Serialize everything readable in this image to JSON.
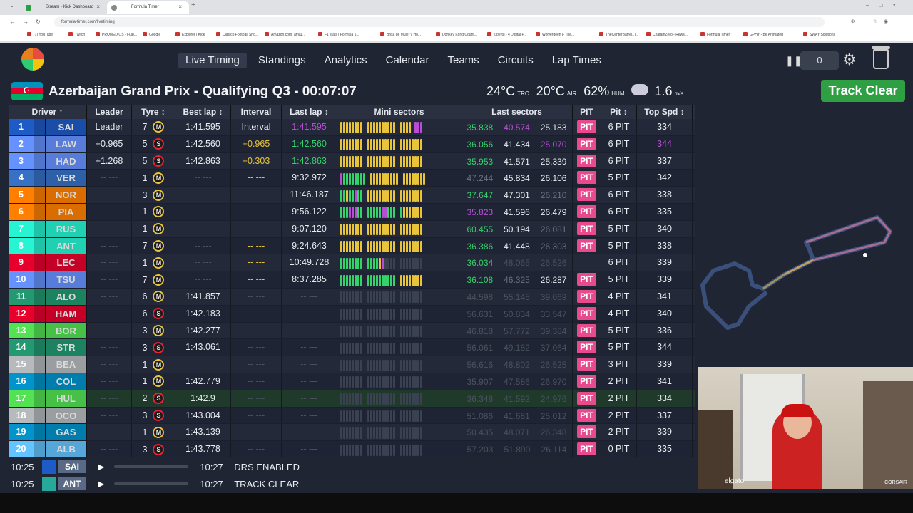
{
  "browser": {
    "tabs": [
      {
        "label": "Stream - Kick Dashboard"
      },
      {
        "label": "Formula Timer"
      }
    ],
    "url": "formula-timer.com/livetiming",
    "bookmarks": [
      "(1) YouTube",
      "Twitch",
      "PROMEDIOS - Fulb...",
      "Google",
      "Explorer | Kick",
      "Clasico Football Sho...",
      "Amazon.com: amaz...",
      "F1 stats | Formula 1...",
      "Brisa de Mujer y Ho...",
      "Donkey Kong Count...",
      "Zipertu - 4 Digital P...",
      "Wolverdeen F The...",
      "TheCenterBarrel1T...",
      "ChatamZero - Rews...",
      "Formula Timer",
      "GPHY - Be Animated",
      "SWAY Solutions"
    ]
  },
  "nav": {
    "items": [
      "Live Timing",
      "Standings",
      "Analytics",
      "Calendar",
      "Teams",
      "Circuits",
      "Lap Times"
    ],
    "counter": "0"
  },
  "session": {
    "title": "Azerbaijan Grand Prix - Qualifying Q3 - 00:07:07",
    "track_temp": "24°C",
    "track_temp_unit": "TRC",
    "air_temp": "20°C",
    "air_temp_unit": "AIR",
    "humidity": "62%",
    "humidity_unit": "HUM",
    "wind": "1.6",
    "wind_unit": "m/s",
    "status": "Track Clear"
  },
  "columns": [
    "Driver ↑",
    "Leader",
    "Tyre ↕",
    "Best lap ↕",
    "Interval",
    "Last lap ↕",
    "Mini sectors",
    "Last sectors",
    "PIT",
    "Pit ↕",
    "Top Spd ↕"
  ],
  "colors": {
    "pit": "#e84a8e",
    "purple": "#b94cd6",
    "green": "#33d26a",
    "yellow": "#e8c43a",
    "track_clear": "#2ea043"
  },
  "drivers": [
    {
      "pos": "1",
      "code": "SAI",
      "team_color": "#1e5bc6",
      "leader": "Leader",
      "laps": "7",
      "tyre": "M",
      "best": "1:41.595",
      "interval": "Interval",
      "last": "1:41.595",
      "last_c": "purple",
      "s1": "35.838",
      "s1c": "green",
      "s2": "40.574",
      "s2c": "purple",
      "s3": "25.183",
      "s3c": "",
      "pit": "PIT",
      "pits": "6 PIT",
      "spd": "334",
      "spd_c": "",
      "mini": "yyyyyyyy|yyyyyyyyyy|yyyymppp"
    },
    {
      "pos": "2",
      "code": "LAW",
      "team_color": "#6692ff",
      "leader": "+0.965",
      "laps": "5",
      "tyre": "S",
      "best": "1:42.560",
      "interval": "+0.965",
      "int_c": "yellow",
      "last": "1:42.560",
      "last_c": "green",
      "s1": "36.056",
      "s1c": "",
      "s2": "41.434",
      "s2c": "",
      "s3": "25.070",
      "s3c": "purple",
      "pit": "PIT",
      "pits": "6 PIT",
      "spd": "344",
      "spd_c": "purple",
      "mini": "yyyyyyyy|yyyyyyyyyy|yyyyyyyy"
    },
    {
      "pos": "3",
      "code": "HAD",
      "team_color": "#6692ff",
      "leader": "+1.268",
      "laps": "5",
      "tyre": "S",
      "best": "1:42.863",
      "interval": "+0.303",
      "int_c": "yellow",
      "last": "1:42.863",
      "last_c": "green",
      "s1": "35.953",
      "s1c": "",
      "s2": "41.571",
      "s2c": "",
      "s3": "25.339",
      "s3c": "",
      "pit": "PIT",
      "pits": "6 PIT",
      "spd": "337",
      "spd_c": "",
      "mini": "yyyyyyyy|yyyyyyyyyy|yyyyyyyy"
    },
    {
      "pos": "4",
      "code": "VER",
      "team_color": "#3671c6",
      "leader": "-- ---",
      "laps": "1",
      "tyre": "M",
      "best": "-- ---",
      "interval": "-- ---",
      "int_c": "yellow",
      "last": "9:32.972",
      "last_c": "",
      "s1": "47.244",
      "s1c": "dim",
      "s2": "45.834",
      "s2c": "",
      "s3": "26.106",
      "s3c": "",
      "pit": "PIT",
      "pits": "5 PIT",
      "spd": "342",
      "spd_c": "",
      "mini": "pgggggggg|yyyyyyyyyy|yyyyyyyy"
    },
    {
      "pos": "5",
      "code": "NOR",
      "team_color": "#ff8000",
      "leader": "-- ---",
      "laps": "3",
      "tyre": "M",
      "best": "-- ---",
      "interval": "-- ---",
      "int_c": "yellow",
      "last": "11:46.187",
      "last_c": "",
      "s1": "37.647",
      "s1c": "",
      "s2": "47.301",
      "s2c": "",
      "s3": "26.210",
      "s3c": "dim",
      "pit": "PIT",
      "pits": "6 PIT",
      "spd": "338",
      "spd_c": "",
      "mini": "ggyggpgg|yyyyyyyyyy|yyyyyyyy"
    },
    {
      "pos": "6",
      "code": "PIA",
      "team_color": "#ff8000",
      "leader": "-- ---",
      "laps": "1",
      "tyre": "M",
      "best": "-- ---",
      "interval": "-- ---",
      "int_c": "yellow",
      "last": "9:56.122",
      "last_c": "",
      "s1": "35.823",
      "s1c": "purple",
      "s2": "41.596",
      "s2c": "",
      "s3": "26.479",
      "s3c": "",
      "pit": "PIT",
      "pits": "6 PIT",
      "spd": "335",
      "spd_c": "",
      "mini": "gggpppgg|gggggppggg|gyyyyyyy"
    },
    {
      "pos": "7",
      "code": "RUS",
      "team_color": "#27f4d2",
      "leader": "-- ---",
      "laps": "1",
      "tyre": "M",
      "best": "-- ---",
      "interval": "-- ---",
      "int_c": "yellow",
      "last": "9:07.120",
      "last_c": "",
      "s1": "60.455",
      "s1c": "",
      "s2": "50.194",
      "s2c": "",
      "s3": "26.081",
      "s3c": "dim",
      "pit": "PIT",
      "pits": "5 PIT",
      "spd": "340",
      "spd_c": "",
      "mini": "yyyyyyyy|yyyyyyyyyy|yyyyyyyy"
    },
    {
      "pos": "8",
      "code": "ANT",
      "team_color": "#27f4d2",
      "leader": "-- ---",
      "laps": "7",
      "tyre": "M",
      "best": "-- ---",
      "interval": "-- ---",
      "int_c": "yellow",
      "last": "9:24.643",
      "last_c": "",
      "s1": "36.386",
      "s1c": "",
      "s2": "41.448",
      "s2c": "",
      "s3": "26.303",
      "s3c": "dim",
      "pit": "PIT",
      "pits": "5 PIT",
      "spd": "338",
      "spd_c": "",
      "mini": "yyyyyyyy|yyyyyyyyyy|yyyyyyyy"
    },
    {
      "pos": "9",
      "code": "LEC",
      "team_color": "#e8002d",
      "leader": "-- ---",
      "laps": "1",
      "tyre": "M",
      "best": "-- ---",
      "interval": "-- ---",
      "int_c": "yellow",
      "last": "10:49.728",
      "last_c": "",
      "s1": "36.034",
      "s1c": "",
      "s2": "48.065",
      "s2c": "dim2",
      "s3": "26.526",
      "s3c": "dim2",
      "pit": "",
      "pits": "6 PIT",
      "spd": "339",
      "spd_c": "",
      "mini": "gggggggg|ggggyp....|........"
    },
    {
      "pos": "10",
      "code": "TSU",
      "team_color": "#6692ff",
      "leader": "-- ---",
      "laps": "7",
      "tyre": "M",
      "best": "-- ---",
      "interval": "-- ---",
      "int_c": "yellow",
      "last": "8:37.285",
      "last_c": "",
      "s1": "36.108",
      "s1c": "",
      "s2": "46.325",
      "s2c": "dim",
      "s3": "26.287",
      "s3c": "",
      "pit": "PIT",
      "pits": "5 PIT",
      "spd": "339",
      "spd_c": "",
      "mini": "gggggggg|gggggggggg|yyyyyyyy"
    },
    {
      "pos": "11",
      "code": "ALO",
      "team_color": "#229971",
      "leader": "-- ---",
      "laps": "6",
      "tyre": "M",
      "best": "1:41.857",
      "interval": "-- ---",
      "int_c": "",
      "last": "-- ---",
      "last_c": "",
      "s1": "44.598",
      "s1c": "dim2",
      "s2": "55.145",
      "s2c": "dim2",
      "s3": "39.069",
      "s3c": "dim2",
      "pit": "PIT",
      "pits": "4 PIT",
      "spd": "341",
      "spd_c": "",
      "mini": "........|..........|........"
    },
    {
      "pos": "12",
      "code": "HAM",
      "team_color": "#e8002d",
      "leader": "-- ---",
      "laps": "6",
      "tyre": "S",
      "best": "1:42.183",
      "interval": "-- ---",
      "int_c": "",
      "last": "-- ---",
      "last_c": "",
      "s1": "56.631",
      "s1c": "dim2",
      "s2": "50.834",
      "s2c": "dim2",
      "s3": "33.547",
      "s3c": "dim2",
      "pit": "PIT",
      "pits": "4 PIT",
      "spd": "340",
      "spd_c": "",
      "mini": "........|..........|........"
    },
    {
      "pos": "13",
      "code": "BOR",
      "team_color": "#52e252",
      "leader": "-- ---",
      "laps": "3",
      "tyre": "M",
      "best": "1:42.277",
      "interval": "-- ---",
      "int_c": "",
      "last": "-- ---",
      "last_c": "",
      "s1": "46.818",
      "s1c": "dim2",
      "s2": "57.772",
      "s2c": "dim2",
      "s3": "39.384",
      "s3c": "dim2",
      "pit": "PIT",
      "pits": "5 PIT",
      "spd": "336",
      "spd_c": "",
      "mini": "........|..........|........"
    },
    {
      "pos": "14",
      "code": "STR",
      "team_color": "#229971",
      "leader": "-- ---",
      "laps": "3",
      "tyre": "S",
      "best": "1:43.061",
      "interval": "-- ---",
      "int_c": "",
      "last": "-- ---",
      "last_c": "",
      "s1": "56.061",
      "s1c": "dim2",
      "s2": "49.182",
      "s2c": "dim2",
      "s3": "37.064",
      "s3c": "dim2",
      "pit": "PIT",
      "pits": "5 PIT",
      "spd": "344",
      "spd_c": "",
      "mini": "........|..........|........"
    },
    {
      "pos": "15",
      "code": "BEA",
      "team_color": "#b6babd",
      "leader": "-- ---",
      "laps": "1",
      "tyre": "M",
      "best": "",
      "interval": "-- ---",
      "int_c": "",
      "last": "-- ---",
      "last_c": "",
      "s1": "56.616",
      "s1c": "dim2",
      "s2": "48.802",
      "s2c": "dim2",
      "s3": "26.525",
      "s3c": "dim2",
      "pit": "PIT",
      "pits": "3 PIT",
      "spd": "339",
      "spd_c": "",
      "mini": "........|..........|........"
    },
    {
      "pos": "16",
      "code": "COL",
      "team_color": "#0093cc",
      "leader": "-- ---",
      "laps": "1",
      "tyre": "M",
      "best": "1:42.779",
      "interval": "-- ---",
      "int_c": "",
      "last": "-- ---",
      "last_c": "",
      "s1": "35.907",
      "s1c": "dim2",
      "s2": "47.586",
      "s2c": "dim2",
      "s3": "26.970",
      "s3c": "dim2",
      "pit": "PIT",
      "pits": "2 PIT",
      "spd": "341",
      "spd_c": "",
      "mini": "........|..........|........"
    },
    {
      "pos": "17",
      "code": "HUL",
      "team_color": "#52e252",
      "leader": "-- ---",
      "laps": "2",
      "tyre": "S",
      "best": "1:42.9",
      "interval": "-- ---",
      "int_c": "",
      "last": "-- ---",
      "last_c": "",
      "s1": "36.348",
      "s1c": "dim2",
      "s2": "41.592",
      "s2c": "dim2",
      "s3": "24.976",
      "s3c": "dim2",
      "pit": "PIT",
      "pits": "2 PIT",
      "spd": "334",
      "spd_c": "",
      "mini": "........|..........|........"
    },
    {
      "pos": "18",
      "code": "OCO",
      "team_color": "#b6babd",
      "leader": "-- ---",
      "laps": "3",
      "tyre": "S",
      "best": "1:43.004",
      "interval": "-- ---",
      "int_c": "",
      "last": "-- ---",
      "last_c": "",
      "s1": "51.086",
      "s1c": "dim2",
      "s2": "41.681",
      "s2c": "dim2",
      "s3": "25.012",
      "s3c": "dim2",
      "pit": "PIT",
      "pits": "2 PIT",
      "spd": "337",
      "spd_c": "",
      "mini": "........|..........|........"
    },
    {
      "pos": "19",
      "code": "GAS",
      "team_color": "#0093cc",
      "leader": "-- ---",
      "laps": "1",
      "tyre": "M",
      "best": "1:43.139",
      "interval": "-- ---",
      "int_c": "",
      "last": "-- ---",
      "last_c": "",
      "s1": "50.435",
      "s1c": "dim2",
      "s2": "48.071",
      "s2c": "dim2",
      "s3": "26.348",
      "s3c": "dim2",
      "pit": "PIT",
      "pits": "2 PIT",
      "spd": "339",
      "spd_c": "",
      "mini": "........|..........|........"
    },
    {
      "pos": "20",
      "code": "ALB",
      "team_color": "#64c4ff",
      "leader": "-- ---",
      "laps": "3",
      "tyre": "S",
      "best": "1:43.778",
      "interval": "-- ---",
      "int_c": "",
      "last": "-- ---",
      "last_c": "",
      "s1": "57.203",
      "s1c": "dim2",
      "s2": "51.890",
      "s2c": "dim2",
      "s3": "26.114",
      "s3c": "dim2",
      "pit": "PIT",
      "pits": "0 PIT",
      "spd": "335",
      "spd_c": "",
      "mini": "........|..........|........"
    }
  ],
  "messages": [
    {
      "time": "10:25",
      "code": "SAI",
      "msg_time": "10:27",
      "msg": "DRS ENABLED"
    },
    {
      "time": "10:25",
      "code": "ANT",
      "msg_time": "10:27",
      "msg": "TRACK CLEAR"
    }
  ],
  "webcam": {
    "brand": "elgato",
    "brand2": "CORSAIR"
  }
}
